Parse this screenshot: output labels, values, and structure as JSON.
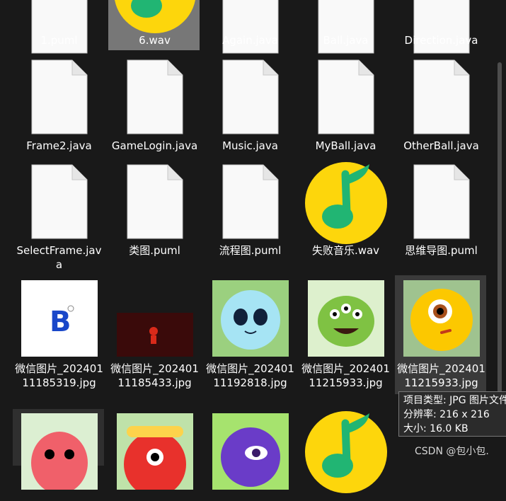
{
  "files": [
    {
      "name": "1.puml",
      "kind": "doc"
    },
    {
      "name": "6.wav",
      "kind": "music",
      "selected": true
    },
    {
      "name": "Again.java",
      "kind": "doc"
    },
    {
      "name": "Ball.java",
      "kind": "doc"
    },
    {
      "name": "Direction.java",
      "kind": "doc"
    },
    {
      "name": "Frame2.java",
      "kind": "doc"
    },
    {
      "name": "GameLogin.java",
      "kind": "doc"
    },
    {
      "name": "Music.java",
      "kind": "doc"
    },
    {
      "name": "MyBall.java",
      "kind": "doc"
    },
    {
      "name": "OtherBall.java",
      "kind": "doc"
    },
    {
      "name": "SelectFrame.java",
      "kind": "doc"
    },
    {
      "name": "类图.puml",
      "kind": "doc"
    },
    {
      "name": "流程图.puml",
      "kind": "doc"
    },
    {
      "name": "失败音乐.wav",
      "kind": "music"
    },
    {
      "name": "思维导图.puml",
      "kind": "doc"
    },
    {
      "name": "微信图片_20240111185319.jpg",
      "kind": "img-b"
    },
    {
      "name": "微信图片_20240111185433.jpg",
      "kind": "img-dark"
    },
    {
      "name": "微信图片_20240111192818.jpg",
      "kind": "img-blue"
    },
    {
      "name": "微信图片_20240111215933.jpg",
      "kind": "img-green"
    },
    {
      "name": "微信图片_20240111215933.jpg",
      "kind": "img-yellow",
      "highlight": true
    },
    {
      "name": "",
      "kind": "img-red",
      "hover": true
    },
    {
      "name": "",
      "kind": "img-redhat"
    },
    {
      "name": "",
      "kind": "img-purple"
    },
    {
      "name": "",
      "kind": "music"
    }
  ],
  "tooltip": {
    "type_line": "项目类型: JPG 图片文件",
    "resolution_line": "分辨率: 216 x 216",
    "size_line": "大小: 16.0 KB"
  },
  "watermark": "CSDN @包小包."
}
